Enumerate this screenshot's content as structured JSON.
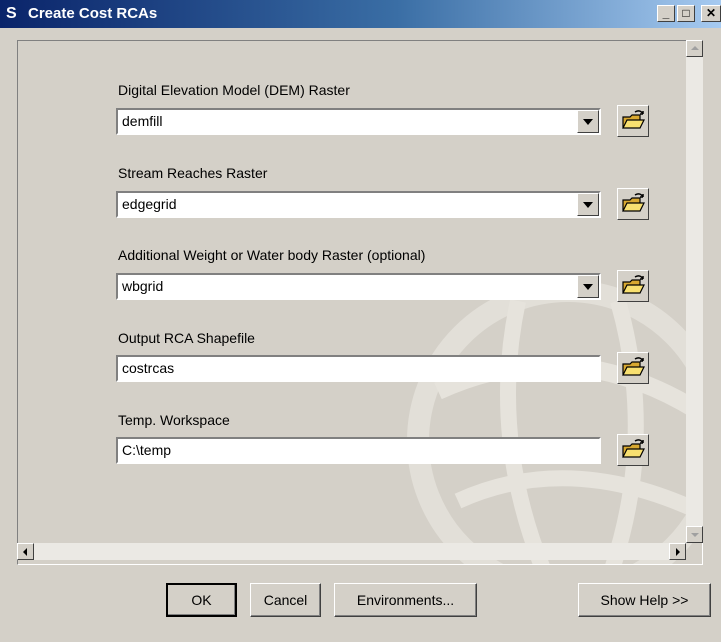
{
  "window": {
    "title": "Create Cost RCAs",
    "title_icon": "S",
    "minimize_glyph": "_",
    "maximize_glyph": "□",
    "close_glyph": "✕"
  },
  "fields": [
    {
      "label": "Digital Elevation Model (DEM) Raster",
      "value": "demfill",
      "type": "combo"
    },
    {
      "label": "Stream Reaches Raster",
      "value": "edgegrid",
      "type": "combo"
    },
    {
      "label": "Additional Weight or Water body Raster (optional)",
      "value": "wbgrid",
      "type": "combo"
    },
    {
      "label": "Output RCA Shapefile",
      "value": "costrcas",
      "type": "text"
    },
    {
      "label": "Temp. Workspace",
      "value": "C:\\temp",
      "type": "text"
    }
  ],
  "buttons": {
    "ok": "OK",
    "cancel": "Cancel",
    "environments": "Environments...",
    "show_help": "Show Help >>"
  },
  "icons": {
    "browse": "open-folder-icon",
    "dropdown": "chevron-down-icon"
  },
  "colors": {
    "titlebar_start": "#0a246a",
    "titlebar_end": "#a6caf0",
    "face": "#d4d0c8"
  }
}
